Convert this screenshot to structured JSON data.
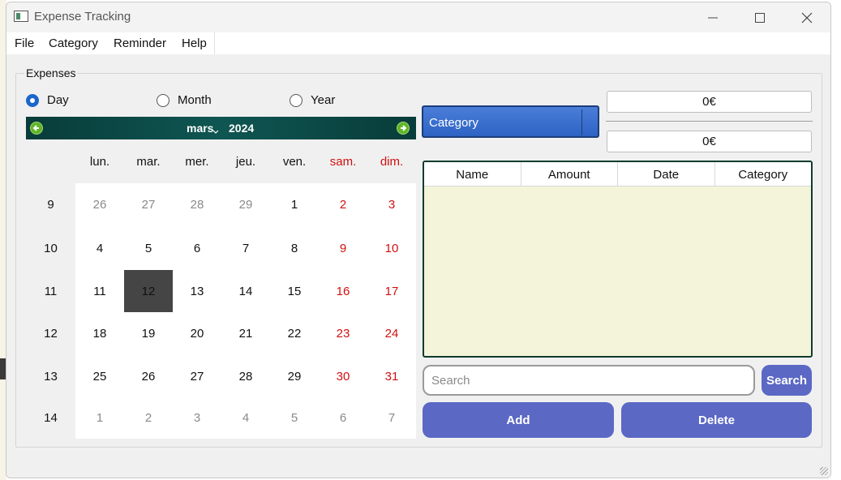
{
  "window": {
    "title": "Expense Tracking"
  },
  "menu": [
    "File",
    "Category",
    "Reminder",
    "Help"
  ],
  "group_title": "Expenses",
  "period": {
    "options": [
      "Day",
      "Month",
      "Year"
    ],
    "selected": "Day"
  },
  "calendar": {
    "month": "mars",
    "year": "2024",
    "weekdays": [
      "lun.",
      "mar.",
      "mer.",
      "jeu.",
      "ven.",
      "sam.",
      "dim."
    ],
    "weeks": [
      {
        "num": "9",
        "days": [
          "26",
          "27",
          "28",
          "29",
          "1",
          "2",
          "3"
        ]
      },
      {
        "num": "10",
        "days": [
          "4",
          "5",
          "6",
          "7",
          "8",
          "9",
          "10"
        ]
      },
      {
        "num": "11",
        "days": [
          "11",
          "12",
          "13",
          "14",
          "15",
          "16",
          "17"
        ]
      },
      {
        "num": "12",
        "days": [
          "18",
          "19",
          "20",
          "21",
          "22",
          "23",
          "24"
        ]
      },
      {
        "num": "13",
        "days": [
          "25",
          "26",
          "27",
          "28",
          "29",
          "30",
          "31"
        ]
      },
      {
        "num": "14",
        "days": [
          "1",
          "2",
          "3",
          "4",
          "5",
          "6",
          "7"
        ]
      }
    ],
    "selected_day": "12",
    "weekend_color": "#d01010",
    "muted_color": "#8a8a8a"
  },
  "category_select": {
    "value": "Category"
  },
  "totals": {
    "first": "0€",
    "second": "0€"
  },
  "table": {
    "columns": [
      "Name",
      "Amount",
      "Date",
      "Category"
    ],
    "rows": []
  },
  "search": {
    "placeholder": "Search",
    "button": "Search"
  },
  "actions": {
    "add": "Add",
    "delete": "Delete"
  },
  "colors": {
    "accent_button": "#5b68c4",
    "table_bg": "#f4f4da",
    "calendar_nav": "#0f5652"
  }
}
